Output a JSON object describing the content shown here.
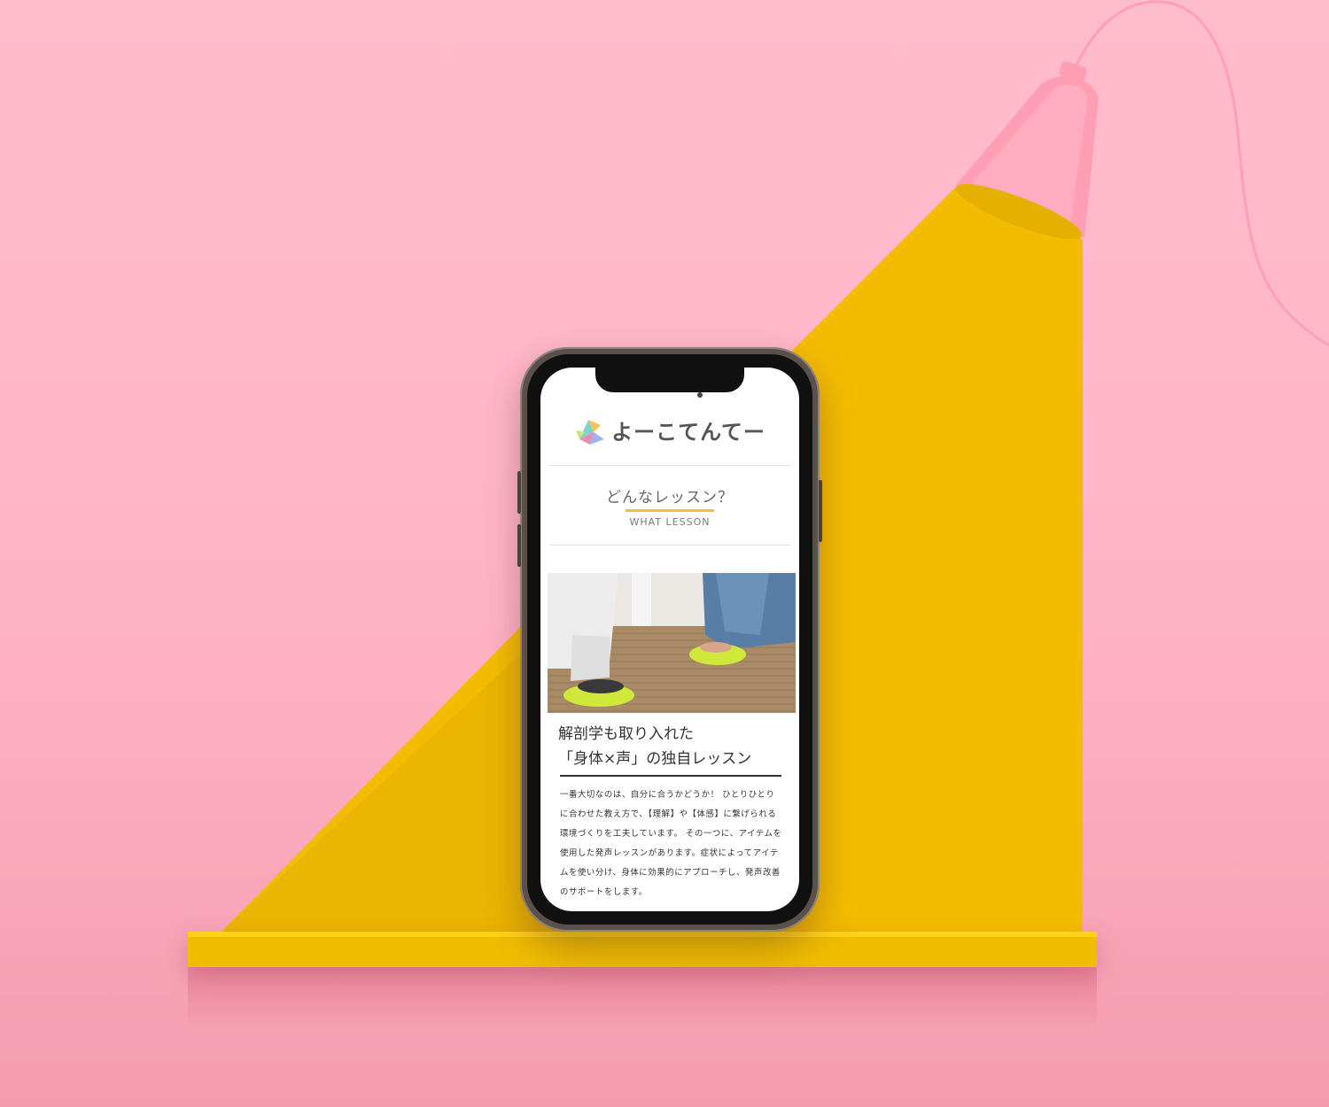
{
  "colors": {
    "background": "#ffb8c9",
    "shelf": "#f0bd00",
    "beam": "#f4bc00",
    "lamp": "#ff9fb6",
    "accent_underline": "#f3bd3d"
  },
  "phone": {
    "logo_text": "よーこてんてー",
    "section": {
      "title": "どんなレッスン？",
      "subtitle": "WHAT LESSON"
    },
    "photo_alt": "lesson-photo-balance-cushions",
    "headline": {
      "line1": "解剖学も取り入れた",
      "line2": "「身体×声」の独自レッスン"
    },
    "body": "一番大切なのは、自分に合うかどうか！ ひとりひとりに合わせた教え方で、【理解】や【体感】に繋げられる環境づくりを工夫しています。 その一つに、アイテムを使用した発声レッスンがあります。症状によってアイテムを使い分け、身体に効果的にアプローチし、発声改善のサポートをします。"
  },
  "icons": [
    "lamp-icon",
    "logo-icon"
  ]
}
